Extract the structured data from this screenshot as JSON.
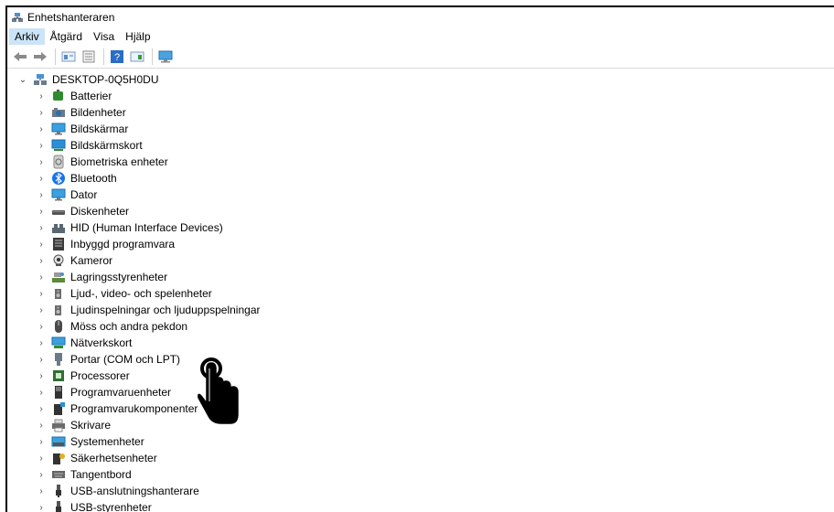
{
  "window": {
    "title": "Enhetshanteraren"
  },
  "menu": {
    "items": [
      {
        "label": "Arkiv",
        "active": true
      },
      {
        "label": "Åtgärd",
        "active": false
      },
      {
        "label": "Visa",
        "active": false
      },
      {
        "label": "Hjälp",
        "active": false
      }
    ]
  },
  "toolbar": {
    "buttons": [
      "back-arrow-icon",
      "forward-arrow-icon",
      "properties-icon",
      "scan-icon",
      "help-icon",
      "view-icon",
      "monitor-icon"
    ]
  },
  "tree": {
    "root": {
      "label": "DESKTOP-0Q5H0DU",
      "expanded": true
    },
    "items": [
      {
        "label": "Batterier",
        "icon": "battery-icon"
      },
      {
        "label": "Bildenheter",
        "icon": "camera-device-icon"
      },
      {
        "label": "Bildskärmar",
        "icon": "monitor-icon"
      },
      {
        "label": "Bildskärmskort",
        "icon": "display-adapter-icon"
      },
      {
        "label": "Biometriska enheter",
        "icon": "fingerprint-icon"
      },
      {
        "label": "Bluetooth",
        "icon": "bluetooth-icon"
      },
      {
        "label": "Dator",
        "icon": "computer-icon"
      },
      {
        "label": "Diskenheter",
        "icon": "disk-icon"
      },
      {
        "label": "HID (Human Interface Devices)",
        "icon": "hid-icon"
      },
      {
        "label": "Inbyggd programvara",
        "icon": "firmware-icon"
      },
      {
        "label": "Kameror",
        "icon": "webcam-icon"
      },
      {
        "label": "Lagringsstyrenheter",
        "icon": "storage-controller-icon"
      },
      {
        "label": "Ljud-, video- och spelenheter",
        "icon": "speaker-icon"
      },
      {
        "label": "Ljudinspelningar och ljuduppspelningar",
        "icon": "speaker-icon"
      },
      {
        "label": "Möss och andra pekdon",
        "icon": "mouse-icon"
      },
      {
        "label": "Nätverkskort",
        "icon": "network-icon"
      },
      {
        "label": "Portar (COM och LPT)",
        "icon": "port-icon"
      },
      {
        "label": "Processorer",
        "icon": "processor-icon"
      },
      {
        "label": "Programvaruenheter",
        "icon": "software-device-icon"
      },
      {
        "label": "Programvarukomponenter",
        "icon": "software-component-icon"
      },
      {
        "label": "Skrivare",
        "icon": "printer-icon"
      },
      {
        "label": "Systemenheter",
        "icon": "system-device-icon"
      },
      {
        "label": "Säkerhetsenheter",
        "icon": "security-device-icon"
      },
      {
        "label": "Tangentbord",
        "icon": "keyboard-icon"
      },
      {
        "label": "USB-anslutningshanterare",
        "icon": "usb-icon"
      },
      {
        "label": "USB-styrenheter",
        "icon": "usb-icon"
      }
    ]
  },
  "colors": {
    "menu_active_bg": "#cce4f7",
    "bluetooth_blue": "#1a73e8",
    "monitor_blue": "#2a8fd6"
  }
}
